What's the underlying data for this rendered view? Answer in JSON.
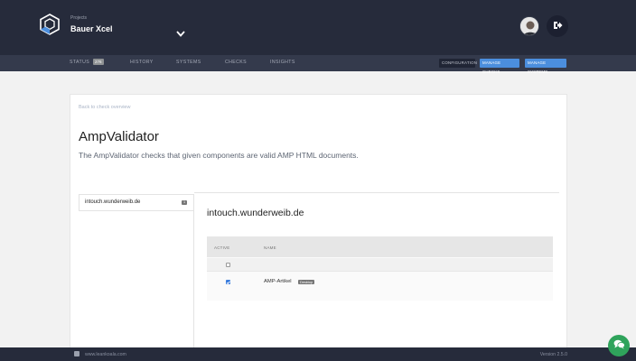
{
  "header": {
    "projects_caption": "Projects",
    "project_name": "Bauer Xcel"
  },
  "nav": {
    "items": [
      "STATUS",
      "HISTORY",
      "SYSTEMS",
      "CHECKS",
      "INSIGHTS"
    ],
    "status_badge": "276",
    "right_buttons": [
      "CONFIGURATION",
      "MANAGE CHECKS",
      "MANAGE SYSTEMS"
    ]
  },
  "main": {
    "back_link": "Back to check overview",
    "title": "AmpValidator",
    "description": "The AmpValidator checks that given components are valid AMP HTML documents.",
    "sidebar": {
      "items": [
        {
          "label": "intouch.wunderweib.de",
          "count": "1"
        }
      ]
    },
    "section_title": "intouch.wunderweib.de",
    "table": {
      "headers": [
        "ACTIVE",
        "NAME"
      ],
      "rows": [
        {
          "active": false,
          "name": "",
          "tag": ""
        },
        {
          "active": true,
          "name": "AMP-Artikel",
          "tag": "Desktop"
        }
      ]
    }
  },
  "footer": {
    "url": "www.leankoala.com",
    "version": "Version 2.5.0"
  },
  "colors": {
    "header_bg": "#262b3b",
    "nav_bg": "#343a4c",
    "accent": "#4b8ede",
    "chat_green": "#2fa35b"
  }
}
